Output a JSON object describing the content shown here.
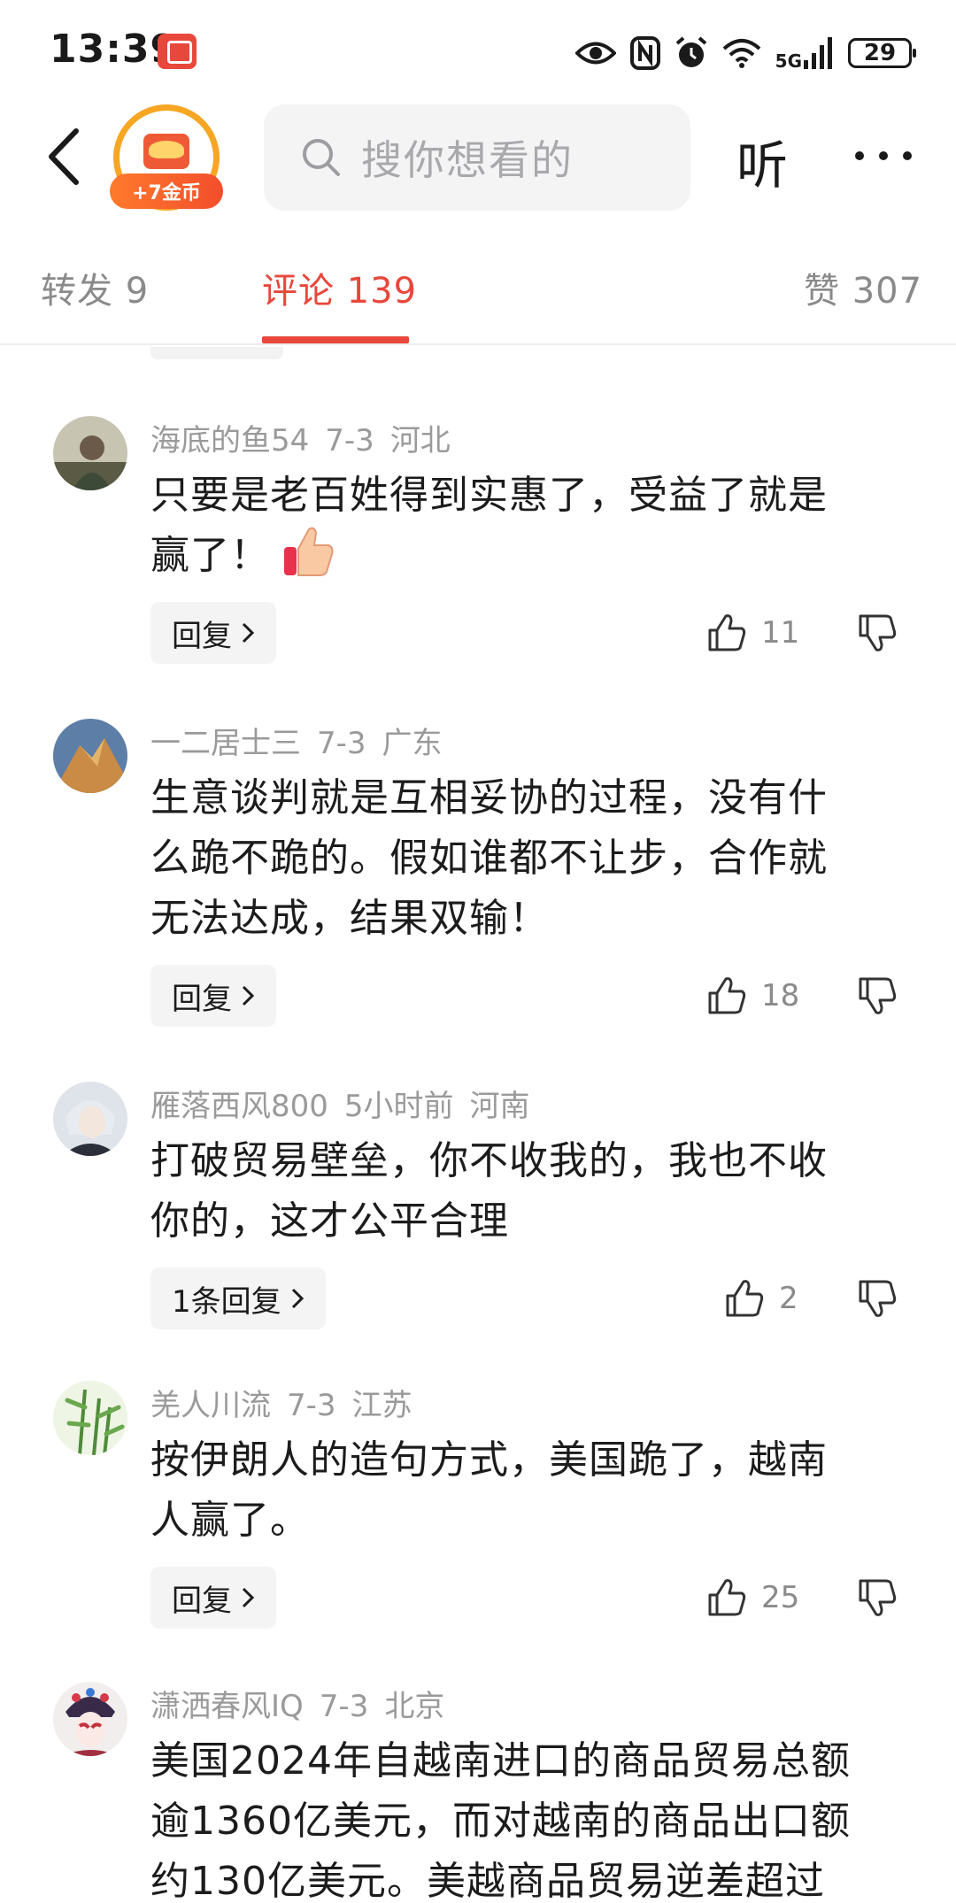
{
  "status_bar": {
    "time": "13:39",
    "network": "5G",
    "battery": "29",
    "icons": [
      "eye-icon",
      "nfc-icon",
      "alarm-icon",
      "wifi-icon",
      "signal-icon",
      "battery-icon"
    ]
  },
  "header": {
    "coin_reward": "+7金币",
    "search_placeholder": "搜你想看的",
    "listen_label": "听",
    "icons": [
      "back-arrow-icon",
      "search-icon",
      "more-icon"
    ]
  },
  "tabs": [
    {
      "label": "转发 9",
      "active": false
    },
    {
      "label": "评论 139",
      "active": true
    },
    {
      "label": "赞 307",
      "active": false
    }
  ],
  "colors": {
    "accent": "#e8473b",
    "coin_orange": "#f6a623",
    "muted_text": "#9a9a9a",
    "button_bg": "#f4f4f5"
  },
  "comments": [
    {
      "user": "海底的鱼54",
      "time": "7-3",
      "location": "河北",
      "lines": [
        "只要是老百姓得到实惠了，受益了就是",
        "赢了！"
      ],
      "has_thumb_emoji": true,
      "reply_label": "回复",
      "likes": "11"
    },
    {
      "user": "一二居士三",
      "time": "7-3",
      "location": "广东",
      "lines": [
        "生意谈判就是互相妥协的过程，没有什",
        "么跪不跪的。假如谁都不让步，合作就",
        "无法达成，结果双输！"
      ],
      "reply_label": "回复",
      "likes": "18"
    },
    {
      "user": "雁落西风800",
      "time": "5小时前",
      "location": "河南",
      "lines": [
        "打破贸易壁垒，你不收我的，我也不收",
        "你的，这才公平合理"
      ],
      "reply_label": "1条回复",
      "likes": "2"
    },
    {
      "user": "羌人川流",
      "time": "7-3",
      "location": "江苏",
      "lines": [
        "按伊朗人的造句方式，美国跪了，越南",
        "人赢了。"
      ],
      "reply_label": "回复",
      "likes": "25"
    },
    {
      "user": "潇洒春风IQ",
      "time": "7-3",
      "location": "北京",
      "lines": [
        "美国2024年自越南进口的商品贸易总额",
        "逾1360亿美元，而对越南的商品出口额",
        "约130亿美元。美越商品贸易逆差超过"
      ]
    }
  ]
}
